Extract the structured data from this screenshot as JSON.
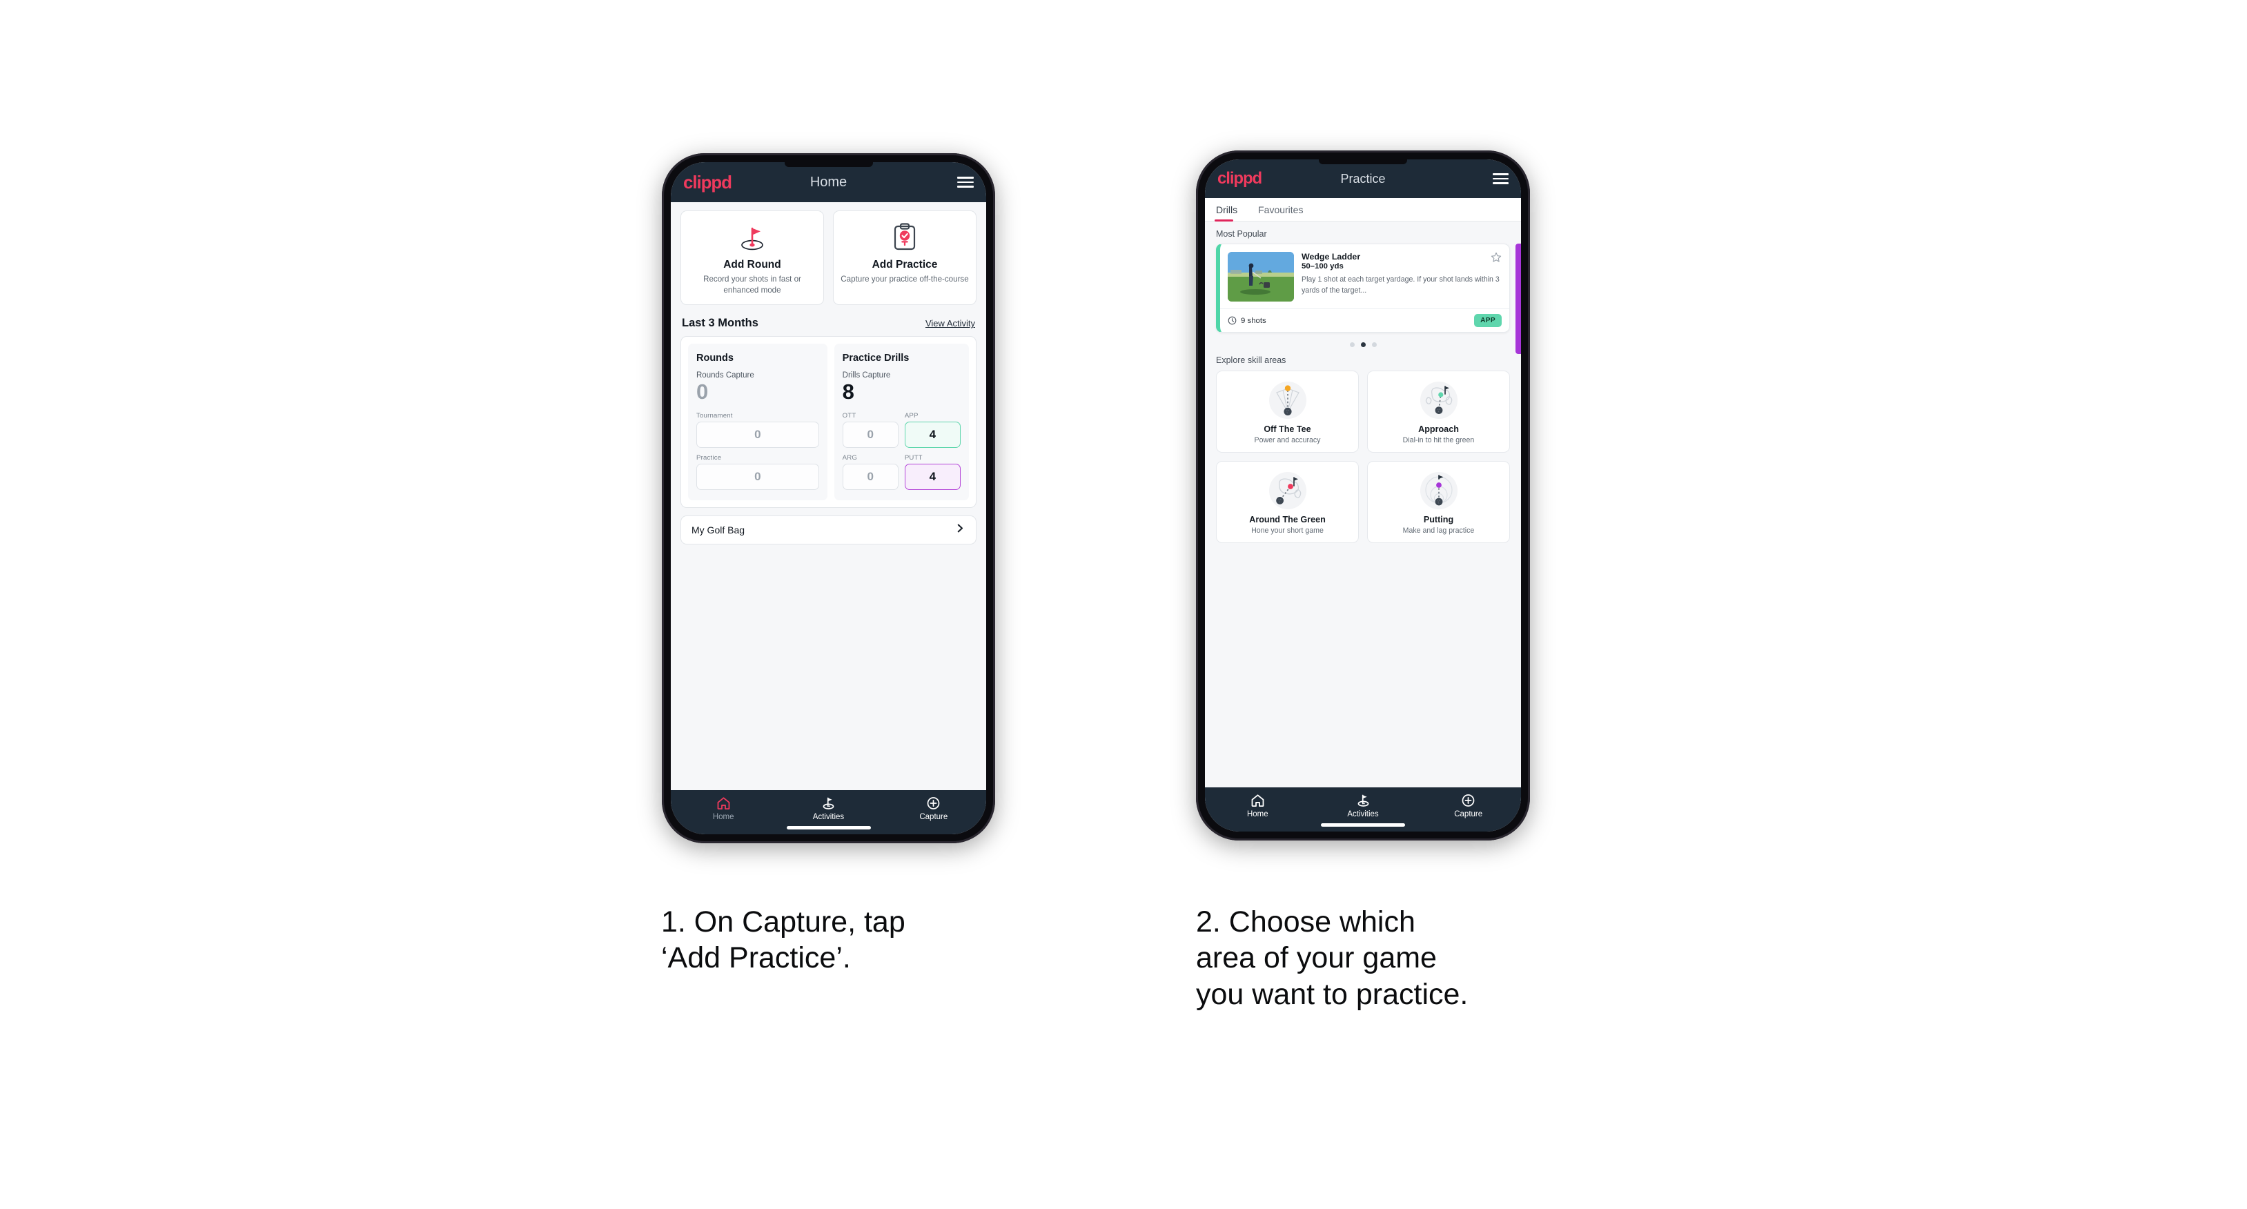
{
  "phone1": {
    "appbar": {
      "brand": "clippd",
      "title": "Home",
      "menu_icon": "hamburger-icon"
    },
    "actions": [
      {
        "icon": "golf-flag-icon",
        "title": "Add Round",
        "subtitle": "Record your shots in fast or enhanced mode"
      },
      {
        "icon": "clipboard-check-icon",
        "title": "Add Practice",
        "subtitle": "Capture your practice off-the-course"
      }
    ],
    "section": {
      "title": "Last 3 Months",
      "link": "View Activity"
    },
    "rounds": {
      "heading": "Rounds",
      "caption": "Rounds Capture",
      "total": "0",
      "metrics": [
        {
          "label": "Tournament",
          "value": "0",
          "state": "default"
        },
        {
          "label": "Practice",
          "value": "0",
          "state": "default"
        }
      ]
    },
    "drills": {
      "heading": "Practice Drills",
      "caption": "Drills Capture",
      "total": "8",
      "metrics": [
        {
          "label": "OTT",
          "value": "0",
          "state": "default"
        },
        {
          "label": "APP",
          "value": "4",
          "state": "app"
        },
        {
          "label": "ARG",
          "value": "0",
          "state": "default"
        },
        {
          "label": "PUTT",
          "value": "4",
          "state": "putt"
        }
      ]
    },
    "golf_bag": {
      "label": "My Golf Bag",
      "chevron_icon": "chevron-right-icon"
    },
    "nav": [
      {
        "icon": "home-icon",
        "label": "Home",
        "active": true
      },
      {
        "icon": "golf-flag-icon",
        "label": "Activities",
        "active": false
      },
      {
        "icon": "plus-circle-icon",
        "label": "Capture",
        "active": false
      }
    ]
  },
  "phone2": {
    "appbar": {
      "brand": "clippd",
      "title": "Practice",
      "menu_icon": "hamburger-icon"
    },
    "tabs": [
      {
        "label": "Drills",
        "active": true
      },
      {
        "label": "Favourites",
        "active": false
      }
    ],
    "most_popular_label": "Most Popular",
    "drill": {
      "title": "Wedge Ladder",
      "yardage": "50–100 yds",
      "description": "Play 1 shot at each target yardage. If your shot lands within 3 yards of the target...",
      "shots": "9 shots",
      "shots_icon": "clock-icon",
      "badge": "APP",
      "favourite_icon": "star-outline-icon",
      "thumbnail": "golfer-chipping-photo"
    },
    "carousel_dots": {
      "count": 3,
      "active_index": 1
    },
    "explore_label": "Explore skill areas",
    "skills": [
      {
        "icon": "off-the-tee-icon",
        "title": "Off The Tee",
        "subtitle": "Power and accuracy"
      },
      {
        "icon": "approach-icon",
        "title": "Approach",
        "subtitle": "Dial-in to hit the green"
      },
      {
        "icon": "around-the-green-icon",
        "title": "Around The Green",
        "subtitle": "Hone your short game"
      },
      {
        "icon": "putting-icon",
        "title": "Putting",
        "subtitle": "Make and lag practice"
      }
    ],
    "nav": [
      {
        "icon": "home-icon",
        "label": "Home",
        "active": false
      },
      {
        "icon": "golf-flag-icon",
        "label": "Activities",
        "active": false
      },
      {
        "icon": "plus-circle-icon",
        "label": "Capture",
        "active": false
      }
    ]
  },
  "captions": {
    "step1": "1. On Capture, tap\n‘Add Practice’.",
    "step2": "2. Choose which\narea of your game\nyou want to practice."
  },
  "colors": {
    "brand_pink": "#ef3a5d",
    "appbar_navy": "#1e2b38",
    "accent_green": "#5fd6ad",
    "accent_purple": "#a736d8",
    "tab_underline": "#e0255b"
  }
}
